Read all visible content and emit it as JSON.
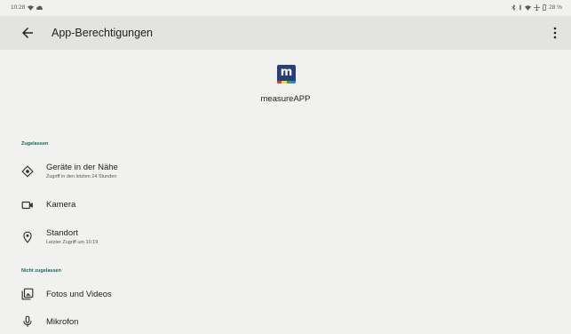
{
  "status_bar": {
    "time": "10:28",
    "battery": "28 %"
  },
  "app_bar": {
    "title": "App-Berechtigungen",
    "back_icon": "arrow-back-icon",
    "menu_icon": "more-vert-icon"
  },
  "app": {
    "logo_letter": "m",
    "name": "measureAPP",
    "colors": {
      "logo_bg": "#24407c",
      "stripe": [
        "#e53935",
        "#fdd835",
        "#43a047",
        "#1e88e5"
      ]
    }
  },
  "sections": {
    "allowed": {
      "title": "Zugelassen",
      "items": [
        {
          "label": "Geräte in der Nähe",
          "subtitle": "Zugriff in den letzten 24 Stunden",
          "icon": "nearby-devices-icon"
        },
        {
          "label": "Kamera",
          "icon": "camera-icon"
        },
        {
          "label": "Standort",
          "subtitle": "Letzter Zugriff um 10:19",
          "icon": "location-icon"
        }
      ]
    },
    "not_allowed": {
      "title": "Nicht zugelassen",
      "items": [
        {
          "label": "Fotos und Videos",
          "icon": "photos-icon"
        },
        {
          "label": "Mikrofon",
          "icon": "microphone-icon"
        }
      ]
    }
  },
  "colors": {
    "background": "#f1f1ef",
    "app_bar": "#e3e3e1",
    "section_accent": "#0a6b5e"
  }
}
